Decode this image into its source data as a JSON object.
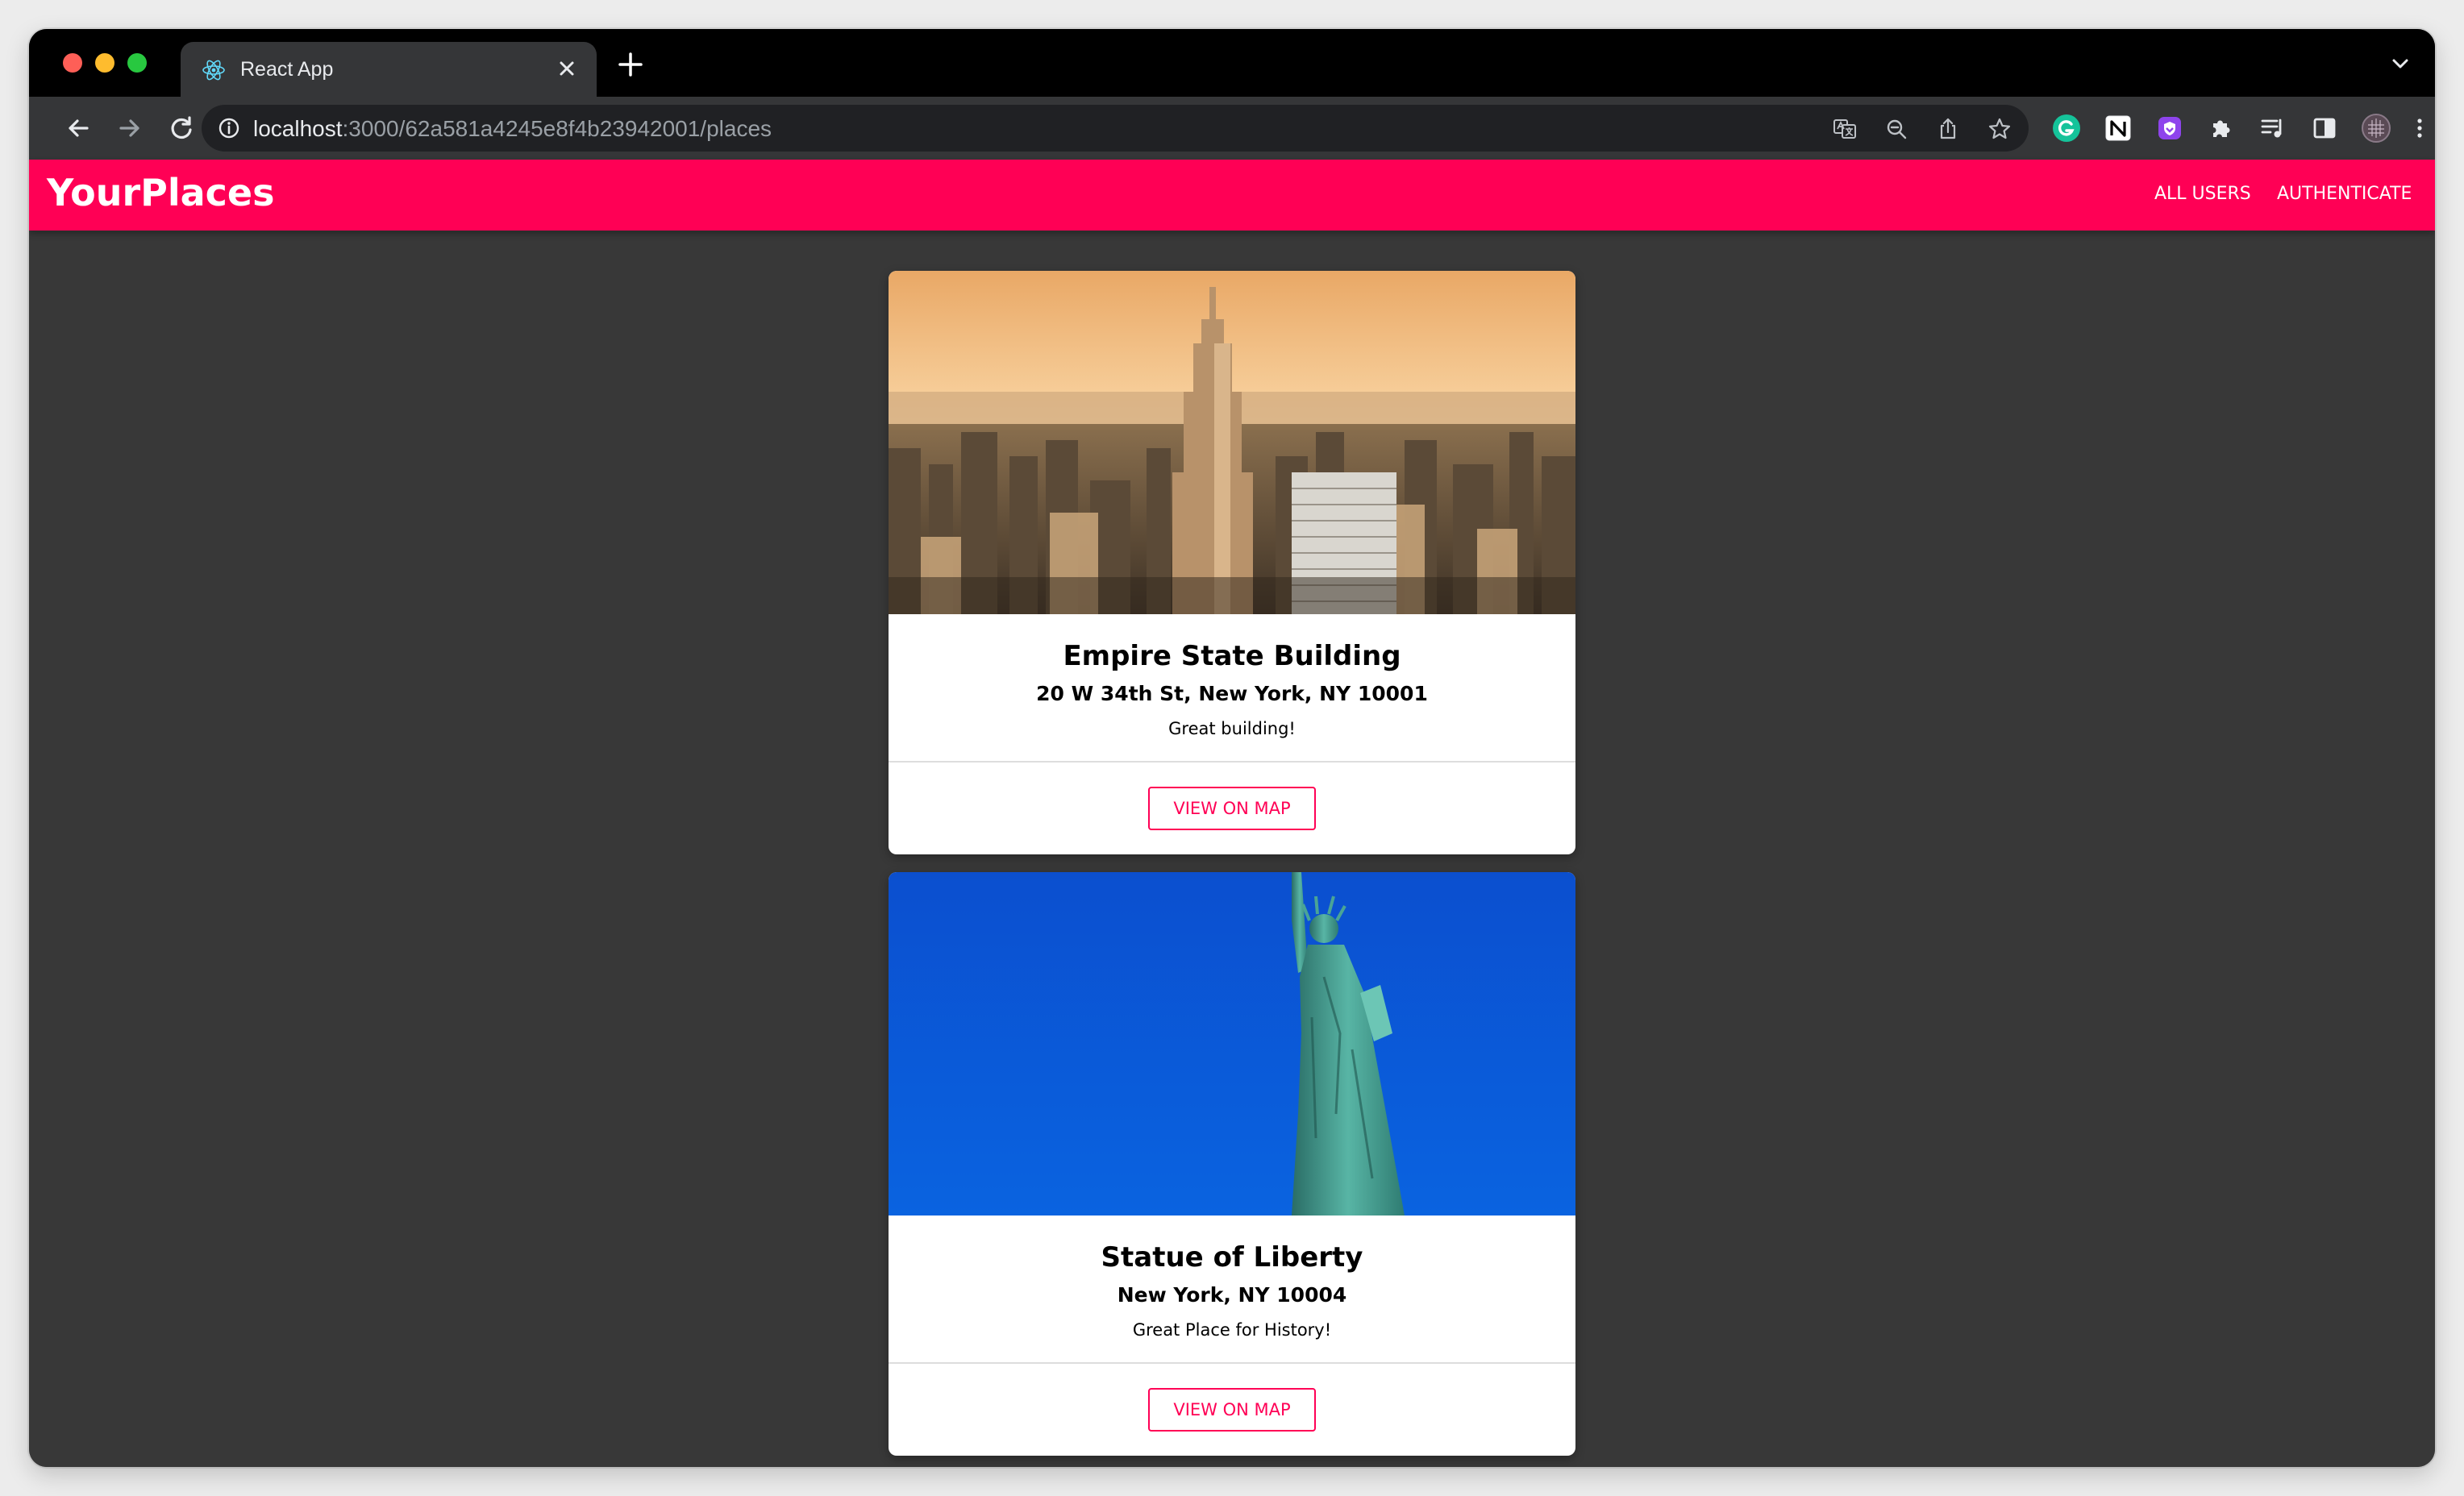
{
  "browser": {
    "tab_title": "React App",
    "url_host": "localhost",
    "url_rest": ":3000/62a581a4245e8f4b23942001/places",
    "icons": [
      "react-icon",
      "close-icon",
      "plus-icon",
      "chevron-down-icon",
      "back-icon",
      "forward-icon",
      "reload-icon",
      "info-icon",
      "translate-icon",
      "zoom-icon",
      "share-icon",
      "star-icon",
      "grammarly-icon",
      "notion-icon",
      "extension-shield-icon",
      "puzzle-icon",
      "media-icon",
      "sidepanel-icon",
      "profile-avatar",
      "more-icon"
    ]
  },
  "app": {
    "brand": "YourPlaces",
    "nav": [
      "ALL USERS",
      "AUTHENTICATE"
    ],
    "brand_color": "#ff0055",
    "places": [
      {
        "title": "Empire State Building",
        "address": "20 W 34th St, New York, NY 10001",
        "description": "Great building!",
        "button": "VIEW ON MAP"
      },
      {
        "title": "Statue of Liberty",
        "address": "New York, NY 10004",
        "description": "Great Place for History!",
        "button": "VIEW ON MAP"
      }
    ]
  }
}
